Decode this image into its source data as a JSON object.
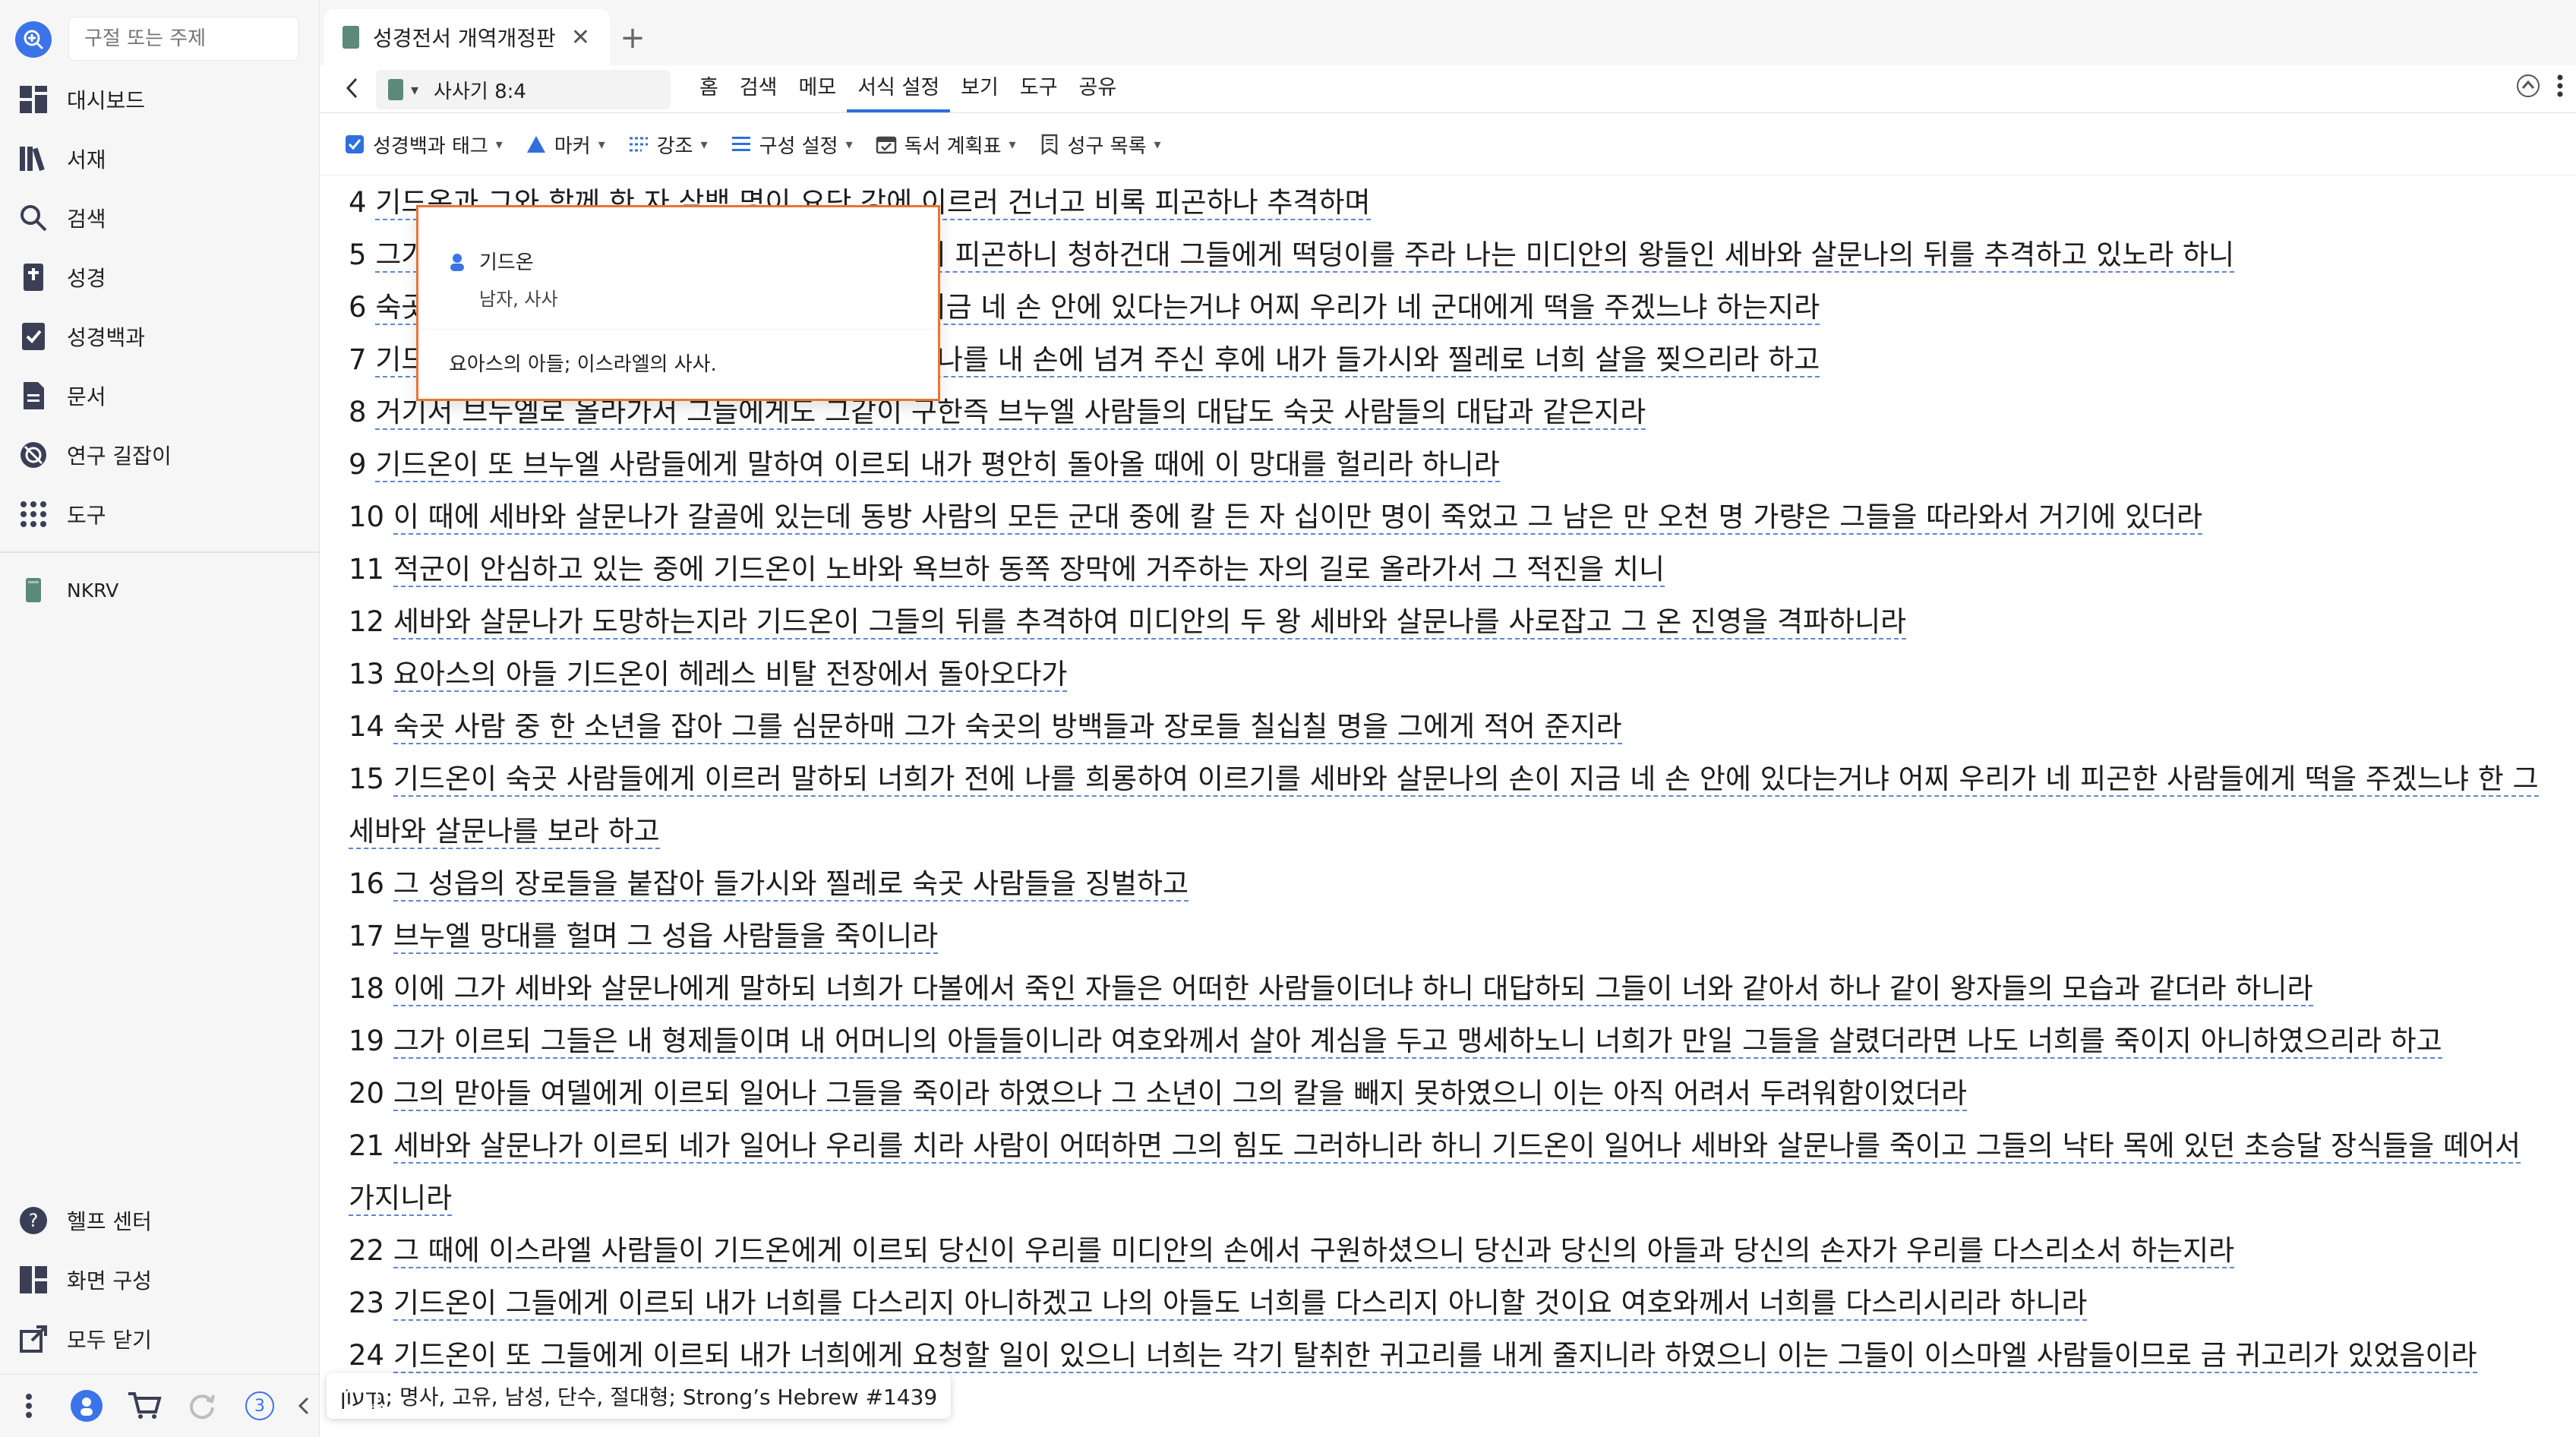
{
  "sidebar": {
    "search_placeholder": "구절 또는 주제",
    "items": [
      {
        "label": "대시보드",
        "icon": "dashboard-icon"
      },
      {
        "label": "서재",
        "icon": "library-icon"
      },
      {
        "label": "검색",
        "icon": "search-icon"
      },
      {
        "label": "성경",
        "icon": "bible-icon"
      },
      {
        "label": "성경백과",
        "icon": "bible-encyclopedia-icon"
      },
      {
        "label": "문서",
        "icon": "document-icon"
      },
      {
        "label": "연구 길잡이",
        "icon": "study-guide-icon"
      },
      {
        "label": "도구",
        "icon": "tools-icon"
      }
    ],
    "pinned": {
      "label": "NKRV",
      "icon": "book-icon"
    },
    "bottom_items": [
      {
        "label": "헬프 센터",
        "icon": "help-icon"
      },
      {
        "label": "화면 구성",
        "icon": "layout-icon"
      },
      {
        "label": "모두 닫기",
        "icon": "close-all-icon"
      }
    ],
    "notification_count": "3"
  },
  "tab": {
    "title": "성경전서 개역개정판"
  },
  "navrow": {
    "reference": "사사기 8:4",
    "menus": [
      "홈",
      "검색",
      "메모",
      "서식 설정",
      "보기",
      "도구",
      "공유"
    ],
    "active_menu": "서식 설정"
  },
  "toolbar": [
    {
      "label": "성경백과 태그",
      "icon": "checkbox-icon"
    },
    {
      "label": "마커",
      "icon": "marker-icon"
    },
    {
      "label": "강조",
      "icon": "emphasis-icon"
    },
    {
      "label": "구성 설정",
      "icon": "layout-settings-icon"
    },
    {
      "label": "독서 계획표",
      "icon": "calendar-icon"
    },
    {
      "label": "성구 목록",
      "icon": "bookmark-list-icon"
    }
  ],
  "verses": [
    {
      "num": "4",
      "text": "기드온과 그와 함께 한 자 삼백 명이 요단 강에 이르러 건너고 비록 피곤하나 추격하며"
    },
    {
      "num": "5",
      "text": "그가 숙곳 사람들에게 이르되 나를 따르는 백성이 피곤하니 청하건대 그들에게 떡덩이를 주라 나는 미디안의 왕들인 세바와 살문나의 뒤를 추격하고 있노라 하니"
    },
    {
      "num": "6",
      "text": "숙곳의 방백들이 이르되 세바와 살문나의 손이 지금 네 손 안에 있다는거냐 어찌 우리가 네 군대에게 떡을 주겠느냐 하는지라"
    },
    {
      "num": "7",
      "text": "기드온이 이르되 그러면 여호와께서 세바와 살문나를 내 손에 넘겨 주신 후에 내가 들가시와 찔레로 너희 살을 찢으리라 하고"
    },
    {
      "num": "8",
      "text": "거기서 브누엘로 올라가서 그들에게도 그같이 구한즉 브누엘 사람들의 대답도 숙곳 사람들의 대답과 같은지라"
    },
    {
      "num": "9",
      "text": "기드온이 또 브누엘 사람들에게 말하여 이르되 내가 평안히 돌아올 때에 이 망대를 헐리라 하니라"
    },
    {
      "num": "10",
      "text": "이 때에 세바와 살문나가 갈골에 있는데 동방 사람의 모든 군대 중에 칼 든 자 십이만 명이 죽었고 그 남은 만 오천 명 가량은 그들을 따라와서 거기에 있더라"
    },
    {
      "num": "11",
      "text": "적군이 안심하고 있는 중에 기드온이 노바와 욕브하 동쪽 장막에 거주하는 자의 길로 올라가서 그 적진을 치니"
    },
    {
      "num": "12",
      "text": "세바와 살문나가 도망하는지라 기드온이 그들의 뒤를 추격하여 미디안의 두 왕 세바와 살문나를 사로잡고 그 온 진영을 격파하니라"
    },
    {
      "num": "13",
      "text": "요아스의 아들 기드온이 헤레스 비탈 전장에서 돌아오다가"
    },
    {
      "num": "14",
      "text": "숙곳 사람 중 한 소년을 잡아 그를 심문하매 그가 숙곳의 방백들과 장로들 칠십칠 명을 그에게 적어 준지라"
    },
    {
      "num": "15",
      "text": "기드온이 숙곳 사람들에게 이르러 말하되 너희가 전에 나를 희롱하여 이르기를 세바와 살문나의 손이 지금 네 손 안에 있다는거냐 어찌 우리가 네 피곤한 사람들에게 떡을 주겠느냐 한 그 세바와 살문나를 보라 하고"
    },
    {
      "num": "16",
      "text": "그 성읍의 장로들을 붙잡아 들가시와 찔레로 숙곳 사람들을 징벌하고"
    },
    {
      "num": "17",
      "text": "브누엘 망대를 헐며 그 성읍 사람들을 죽이니라"
    },
    {
      "num": "18",
      "text": "이에 그가 세바와 살문나에게 말하되 너희가 다볼에서 죽인 자들은 어떠한 사람들이더냐 하니 대답하되 그들이 너와 같아서 하나 같이 왕자들의 모습과 같더라 하니라"
    },
    {
      "num": "19",
      "text": "그가 이르되 그들은 내 형제들이며 내 어머니의 아들들이니라 여호와께서 살아 계심을 두고 맹세하노니 너희가 만일 그들을 살렸더라면 나도 너희를 죽이지 아니하였으리라 하고"
    },
    {
      "num": "20",
      "text": "그의 맏아들 여델에게 이르되 일어나 그들을 죽이라 하였으나 그 소년이 그의 칼을 빼지 못하였으니 이는 아직 어려서 두려워함이었더라"
    },
    {
      "num": "21",
      "text": "세바와 살문나가 이르되 네가 일어나 우리를 치라 사람이 어떠하면 그의 힘도 그러하니라 하니 기드온이 일어나 세바와 살문나를 죽이고 그들의 낙타 목에 있던 초승달 장식들을 떼어서 가지니라"
    },
    {
      "num": "22",
      "text": "그 때에 이스라엘 사람들이 기드온에게 이르되 당신이 우리를 미디안의 손에서 구원하셨으니 당신과 당신의 아들과 당신의 손자가 우리를 다스리소서 하는지라"
    },
    {
      "num": "23",
      "text": "기드온이 그들에게 이르되 내가 너희를 다스리지 아니하겠고 나의 아들도 너희를 다스리지 아니할 것이요 여호와께서 너희를 다스리시리라 하니라"
    },
    {
      "num": "24",
      "text": "기드온이 또 그들에게 이르되 내가 너희에게 요청할 일이 있으니 너희는 각기 탈취한 귀고리를 내게 줄지니라 하였으니 이는 그들이 이스마엘 사람들이므로 금 귀고리가 있었음이라"
    }
  ],
  "popup": {
    "name": "기드온",
    "meta": "남자, 사사",
    "definition": "요아스의 아들; 이스라엘의 사사."
  },
  "status_tooltip": "גִּדְעוֹן; 명사, 고유, 남성, 단수, 절대형; Strong’s Hebrew #1439",
  "colors": {
    "accent": "#2f6fde",
    "popup_border": "#e87534",
    "underline": "#5c87d6"
  }
}
